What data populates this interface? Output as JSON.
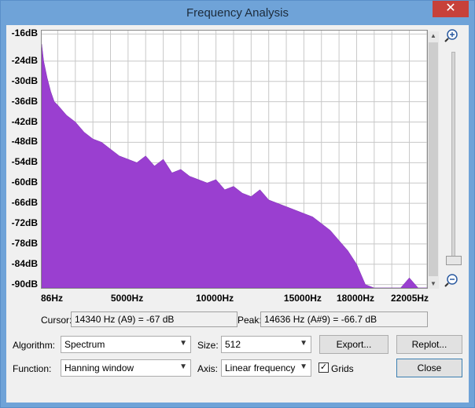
{
  "window": {
    "title": "Frequency Analysis",
    "close_label": "✕"
  },
  "plot": {
    "fill_color": "#9a3fd0",
    "background": "#ffffff",
    "y_labels": [
      "-16dB",
      "-24dB",
      "-30dB",
      "-36dB",
      "-42dB",
      "-48dB",
      "-54dB",
      "-60dB",
      "-66dB",
      "-72dB",
      "-78dB",
      "-84dB",
      "-90dB"
    ],
    "x_labels": [
      "86Hz",
      "5000Hz",
      "10000Hz",
      "15000Hz",
      "18000Hz",
      "22005Hz"
    ]
  },
  "chart_data": {
    "type": "area",
    "xlabel": "",
    "ylabel": "",
    "xlim": [
      86,
      22005
    ],
    "ylim": [
      -91,
      -15
    ],
    "grid": true,
    "x_tick_labels": [
      "86Hz",
      "5000Hz",
      "10000Hz",
      "15000Hz",
      "18000Hz",
      "22005Hz"
    ],
    "y_tick_labels": [
      "-16dB",
      "-24dB",
      "-30dB",
      "-36dB",
      "-42dB",
      "-48dB",
      "-54dB",
      "-60dB",
      "-66dB",
      "-72dB",
      "-78dB",
      "-84dB",
      "-90dB"
    ],
    "x": [
      86,
      200,
      400,
      600,
      800,
      1000,
      1500,
      2000,
      2500,
      3000,
      3500,
      4000,
      4500,
      5000,
      5500,
      6000,
      6500,
      7000,
      7500,
      8000,
      8500,
      9000,
      9500,
      10000,
      10500,
      11000,
      11500,
      12000,
      12500,
      13000,
      13500,
      14000,
      14500,
      15000,
      15500,
      16000,
      16500,
      17000,
      17500,
      18000,
      18500,
      19000,
      19500,
      20000,
      20500,
      21000,
      21500,
      22005
    ],
    "y": [
      -19,
      -24,
      -29,
      -33,
      -36,
      -37,
      -40,
      -42,
      -45,
      -47,
      -48,
      -50,
      -52,
      -53,
      -54,
      -52,
      -55,
      -53,
      -57,
      -56,
      -58,
      -59,
      -60,
      -59,
      -62,
      -61,
      -63,
      -64,
      -62,
      -65,
      -66,
      -67,
      -68,
      -69,
      -70,
      -72,
      -74,
      -77,
      -80,
      -84,
      -90,
      -91,
      -91,
      -91,
      -91,
      -88,
      -91,
      -91
    ]
  },
  "cursor": {
    "label": "Cursor:",
    "value": "14340 Hz (A9) = -67 dB"
  },
  "peak": {
    "label": "Peak:",
    "value": "14636 Hz (A#9) = -66.7 dB"
  },
  "controls": {
    "algorithm_label": "Algorithm:",
    "algorithm_value": "Spectrum",
    "size_label": "Size:",
    "size_value": "512",
    "function_label": "Function:",
    "function_value": "Hanning window",
    "axis_label": "Axis:",
    "axis_value": "Linear frequency",
    "grids_label": "Grids",
    "grids_checked": "✓",
    "export_label": "Export...",
    "replot_label": "Replot...",
    "close_label": "Close"
  }
}
